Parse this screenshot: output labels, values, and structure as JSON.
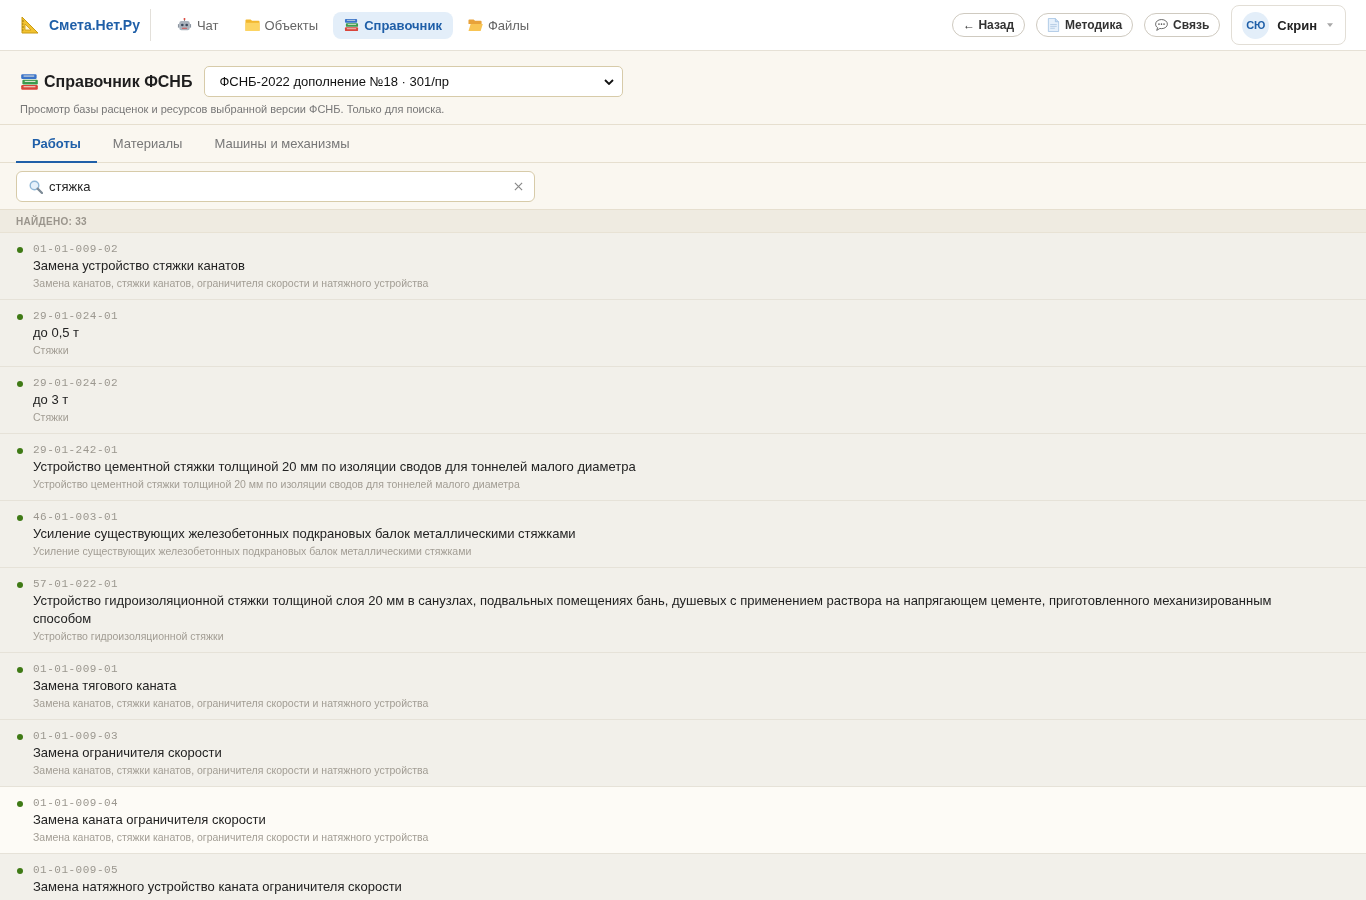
{
  "topbar": {
    "logo": "Смета.Нет.Ру",
    "nav": [
      {
        "label": "Чат",
        "selected": false
      },
      {
        "label": "Объекты",
        "selected": false
      },
      {
        "label": "Справочник",
        "selected": true
      },
      {
        "label": "Файлы",
        "selected": false
      }
    ],
    "actions": [
      "← Назад",
      "Методика",
      "Связь"
    ],
    "user": {
      "initials": "СЮ",
      "name": "Скрин"
    }
  },
  "reference": {
    "title": "Справочник ФСНБ",
    "version": "ФСНБ-2022 дополнение №18 · 301/пр",
    "subtitle": "Просмотр базы расценок и ресурсов выбранной версии ФСНБ. Только для поиска."
  },
  "tabs": [
    {
      "label": "Работы",
      "selected": true
    },
    {
      "label": "Материалы",
      "selected": false
    },
    {
      "label": "Машины и механизмы",
      "selected": false
    }
  ],
  "search": {
    "value": "стяжка"
  },
  "results": {
    "count_label": "НАЙДЕНО: 33",
    "rows": [
      {
        "code": "01-01-009-02",
        "title": "Замена устройство стяжки канатов",
        "description": "Замена канатов, стяжки канатов, ограничителя скорости и натяжного устройства",
        "highlighted": false
      },
      {
        "code": "29-01-024-01",
        "title": "до 0,5 т",
        "description": "Стяжки",
        "highlighted": false
      },
      {
        "code": "29-01-024-02",
        "title": "до 3 т",
        "description": "Стяжки",
        "highlighted": false
      },
      {
        "code": "29-01-242-01",
        "title": "Устройство цементной стяжки толщиной 20 мм по изоляции сводов для тоннелей малого диаметра",
        "description": "Устройство цементной стяжки толщиной 20 мм по изоляции сводов для тоннелей малого диаметра",
        "highlighted": false
      },
      {
        "code": "46-01-003-01",
        "title": "Усиление существующих железобетонных подкрановых балок металлическими стяжками",
        "description": "Усиление существующих железобетонных подкрановых балок металлическими стяжками",
        "highlighted": false
      },
      {
        "code": "57-01-022-01",
        "title": "Устройство гидроизоляционной стяжки толщиной слоя 20 мм в санузлах, подвальных помещениях бань, душевых с применением раствора на напрягающем цементе, приготовленного механизированным способом",
        "description": "Устройство гидроизоляционной стяжки",
        "highlighted": false
      },
      {
        "code": "01-01-009-01",
        "title": "Замена тягового каната",
        "description": "Замена канатов, стяжки канатов, ограничителя скорости и натяжного устройства",
        "highlighted": false
      },
      {
        "code": "01-01-009-03",
        "title": "Замена ограничителя скорости",
        "description": "Замена канатов, стяжки канатов, ограничителя скорости и натяжного устройства",
        "highlighted": false
      },
      {
        "code": "01-01-009-04",
        "title": "Замена каната ограничителя скорости",
        "description": "Замена канатов, стяжки канатов, ограничителя скорости и натяжного устройства",
        "highlighted": true
      },
      {
        "code": "01-01-009-05",
        "title": "Замена натяжного устройство каната ограничителя скорости",
        "highlighted": false
      }
    ]
  }
}
